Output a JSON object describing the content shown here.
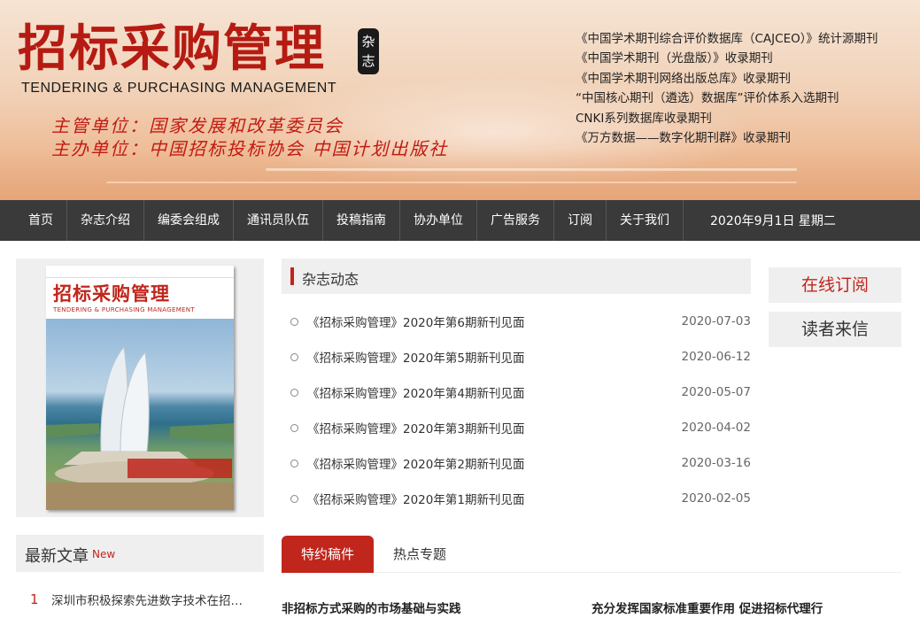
{
  "header": {
    "title_cn": "招标采购管理",
    "tag": "杂志",
    "title_en": "TENDERING & PURCHASING MANAGEMENT",
    "sponsor_line1": "主管单位：国家发展和改革委员会",
    "sponsor_line2": "主办单位：中国招标投标协会  中国计划出版社",
    "indexing": [
      "《中国学术期刊综合评价数据库（CAJCEO）》统计源期刊",
      "《中国学术期刊（光盘版）》收录期刊",
      "《中国学术期刊网络出版总库》收录期刊",
      "“中国核心期刊（遴选）数据库”评价体系入选期刊",
      " CNKI系列数据库收录期刊",
      "《万方数据——数字化期刊群》收录期刊"
    ]
  },
  "nav": {
    "items": [
      "首页",
      "杂志介绍",
      "编委会组成",
      "通讯员队伍",
      "投稿指南",
      "协办单位",
      "广告服务",
      "订阅",
      "关于我们"
    ],
    "date": "2020年9月1日  星期二"
  },
  "cover": {
    "title": "招标采购管理",
    "subtitle": "TENDERING & PURCHASING MANAGEMENT"
  },
  "news": {
    "heading": "杂志动态",
    "items": [
      {
        "title": "《招标采购管理》2020年第6期新刊见面",
        "date": "2020-07-03"
      },
      {
        "title": "《招标采购管理》2020年第5期新刊见面",
        "date": "2020-06-12"
      },
      {
        "title": "《招标采购管理》2020年第4期新刊见面",
        "date": "2020-05-07"
      },
      {
        "title": "《招标采购管理》2020年第3期新刊见面",
        "date": "2020-04-02"
      },
      {
        "title": "《招标采购管理》2020年第2期新刊见面",
        "date": "2020-03-16"
      },
      {
        "title": "《招标采购管理》2020年第1期新刊见面",
        "date": "2020-02-05"
      }
    ]
  },
  "side": {
    "subscribe": "在线订阅",
    "letters": "读者来信"
  },
  "latest": {
    "heading": "最新文章",
    "badge": "New",
    "items": [
      {
        "num": "1",
        "title": "深圳市积极探索先进数字技术在招标投标领域的应用"
      }
    ]
  },
  "tabs": {
    "active": "特约稿件",
    "other": "热点专题"
  },
  "featured": {
    "left": "非招标方式采购的市场基础与实践",
    "right": "充分发挥国家标准重要作用 促进招标代理行"
  },
  "colors": {
    "accent": "#c0261c",
    "nav_bg": "#3a3a3a",
    "panel_bg": "#efefef"
  }
}
